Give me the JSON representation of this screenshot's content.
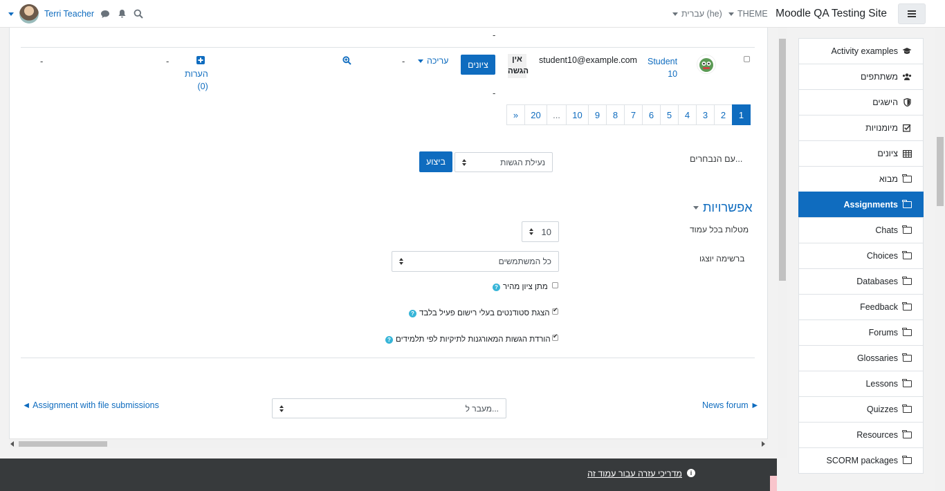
{
  "navbar": {
    "site_name": "Moodle QA Testing Site",
    "theme_label": "THEME",
    "language_label": "עברית (he)",
    "user_name": "Terri Teacher"
  },
  "row": {
    "student_name_line1": "Student",
    "student_name_line2": "10",
    "email": "student10@example.com",
    "status_line1": "אין",
    "status_line2": "הגשה",
    "grade_button": "ציונים",
    "edit_label": "עריכה",
    "dash": "-",
    "comments_label": "הערות",
    "comments_count": "(0)"
  },
  "pagination": {
    "pages": [
      "1",
      "2",
      "3",
      "4",
      "5",
      "6",
      "7",
      "8",
      "9",
      "10",
      "...",
      "20",
      "»"
    ],
    "active": "1"
  },
  "bulk": {
    "label": "עם הנבחרים...",
    "select_value": "נעילת הגשות",
    "go_button": "ביצוע"
  },
  "options": {
    "heading": "אפשרויות",
    "per_page_label": "מטלות בכל עמוד",
    "per_page_value": "10",
    "filter_label": "ברשימה יוצגו",
    "filter_value": "כל המשתמשים",
    "quick_grading_label": "מתן ציון מהיר",
    "quick_grading_checked": false,
    "active_only_label": "הצגת סטודנטים בעלי רישום פעיל בלבד",
    "active_only_checked": true,
    "download_folders_label": "הורדת הגשות המאורגנות לתיקיות לפי תלמידים",
    "download_folders_checked": true
  },
  "nav_footer": {
    "prev_link": "◄ Assignment with file submissions",
    "jump_placeholder": "מעבר ל...",
    "next_link": "News forum ►"
  },
  "footer": {
    "help_link": "מדריכי עזרה עבור עמוד זה"
  },
  "drawer": {
    "items": [
      {
        "label": "Activity examples",
        "icon": "graduation-cap-icon"
      },
      {
        "label": "משתתפים",
        "icon": "users-icon"
      },
      {
        "label": "הישגים",
        "icon": "shield-icon"
      },
      {
        "label": "מיומנויות",
        "icon": "check-square-icon"
      },
      {
        "label": "ציונים",
        "icon": "table-icon"
      },
      {
        "label": "מבוא",
        "icon": "folder-icon"
      },
      {
        "label": "Assignments",
        "icon": "folder-icon",
        "active": true
      },
      {
        "label": "Chats",
        "icon": "folder-icon"
      },
      {
        "label": "Choices",
        "icon": "folder-icon"
      },
      {
        "label": "Databases",
        "icon": "folder-icon"
      },
      {
        "label": "Feedback",
        "icon": "folder-icon"
      },
      {
        "label": "Forums",
        "icon": "folder-icon"
      },
      {
        "label": "Glossaries",
        "icon": "folder-icon"
      },
      {
        "label": "Lessons",
        "icon": "folder-icon"
      },
      {
        "label": "Quizzes",
        "icon": "folder-icon"
      },
      {
        "label": "Resources",
        "icon": "folder-icon"
      },
      {
        "label": "SCORM packages",
        "icon": "folder-icon"
      }
    ]
  },
  "colors": {
    "primary": "#0f6cbf",
    "footer_bg": "#373a3c",
    "help_icon": "#37b5d8"
  }
}
